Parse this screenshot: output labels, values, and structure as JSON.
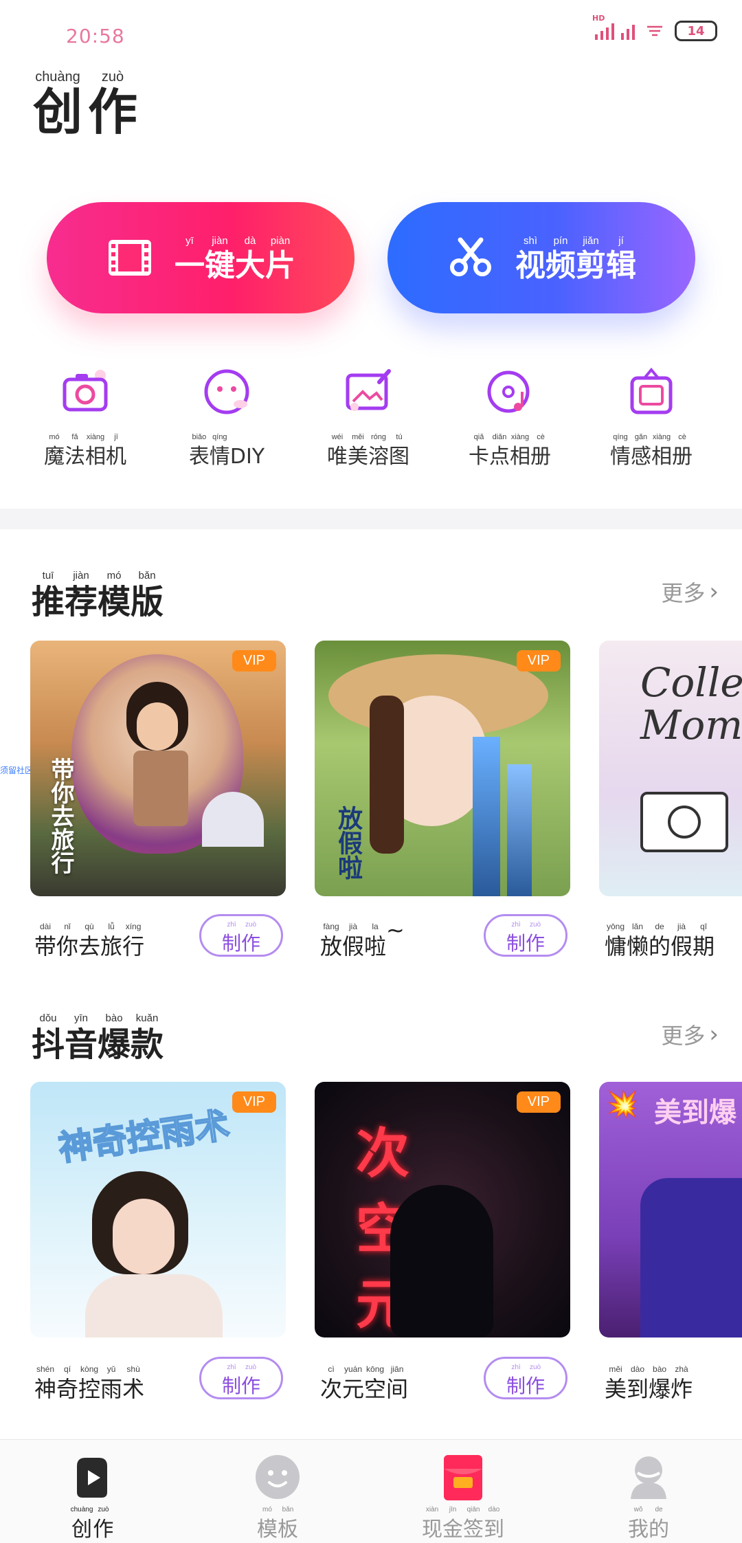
{
  "status_bar": {
    "time": "20:58",
    "network": "HD",
    "battery": "14"
  },
  "header": {
    "title_pinyin": [
      "chuàng",
      "zuò"
    ],
    "title_chars": [
      "创",
      "作"
    ]
  },
  "main_buttons": [
    {
      "pinyin": [
        "yī",
        "jiàn",
        "dà",
        "piàn"
      ],
      "chars": [
        "一",
        "键",
        "大",
        "片"
      ],
      "icon": "film-icon"
    },
    {
      "pinyin": [
        "shì",
        "pín",
        "jiǎn",
        "jí"
      ],
      "chars": [
        "视",
        "频",
        "剪",
        "辑"
      ],
      "icon": "scissors-icon"
    }
  ],
  "tools": [
    {
      "pinyin": [
        "mó",
        "fǎ",
        "xiàng",
        "jī"
      ],
      "chars": [
        "魔",
        "法",
        "相",
        "机"
      ],
      "icon": "camera-icon"
    },
    {
      "pinyin": [
        "biǎo",
        "qíng",
        "",
        ""
      ],
      "chars": [
        "表",
        "情",
        "DIY",
        ""
      ],
      "icon": "smiley-icon"
    },
    {
      "pinyin": [
        "wéi",
        "měi",
        "róng",
        "tú"
      ],
      "chars": [
        "唯",
        "美",
        "溶",
        "图"
      ],
      "icon": "image-edit-icon"
    },
    {
      "pinyin": [
        "qiǎ",
        "diǎn",
        "xiàng",
        "cè"
      ],
      "chars": [
        "卡",
        "点",
        "相",
        "册"
      ],
      "icon": "music-disc-icon"
    },
    {
      "pinyin": [
        "qíng",
        "gǎn",
        "xiàng",
        "cè"
      ],
      "chars": [
        "情",
        "感",
        "相",
        "册"
      ],
      "icon": "tv-frame-icon"
    }
  ],
  "sections": [
    {
      "title_pinyin": [
        "tuī",
        "jiàn",
        "mó",
        "bǎn"
      ],
      "title_chars": [
        "推",
        "荐",
        "模",
        "版"
      ],
      "more_label": "更多",
      "cards": [
        {
          "pinyin": [
            "dài",
            "nǐ",
            "qù",
            "lǚ",
            "xíng"
          ],
          "name": [
            "带",
            "你",
            "去",
            "旅",
            "行"
          ],
          "vip": "VIP",
          "overlay_text": "带你去旅行"
        },
        {
          "pinyin": [
            "fàng",
            "jià",
            "la",
            ""
          ],
          "name": [
            "放",
            "假",
            "啦",
            "~"
          ],
          "vip": "VIP",
          "overlay_text": "放假啦"
        },
        {
          "pinyin": [
            "yōng",
            "lǎn",
            "de",
            "jià",
            "qī"
          ],
          "name": [
            "慵",
            "懒",
            "的",
            "假",
            "期"
          ],
          "vip": "",
          "overlay_text": "Collect Moments"
        }
      ]
    },
    {
      "title_pinyin": [
        "dǒu",
        "yīn",
        "bào",
        "kuǎn"
      ],
      "title_chars": [
        "抖",
        "音",
        "爆",
        "款"
      ],
      "more_label": "更多",
      "cards": [
        {
          "pinyin": [
            "shén",
            "qí",
            "kòng",
            "yǔ",
            "shù"
          ],
          "name": [
            "神",
            "奇",
            "控",
            "雨",
            "术"
          ],
          "vip": "VIP",
          "overlay_text": "神奇控雨术"
        },
        {
          "pinyin": [
            "cì",
            "yuán",
            "kōng",
            "jiān"
          ],
          "name": [
            "次",
            "元",
            "空",
            "间"
          ],
          "vip": "VIP",
          "overlay_text": "次空元间"
        },
        {
          "pinyin": [
            "měi",
            "dào",
            "bào",
            "zhà"
          ],
          "name": [
            "美",
            "到",
            "爆",
            "炸"
          ],
          "vip": "",
          "overlay_text": "美到爆"
        }
      ]
    }
  ],
  "make_button": {
    "pinyin": [
      "zhì",
      "zuò"
    ],
    "chars": [
      "制",
      "作"
    ]
  },
  "watermark": "须留社区 CK",
  "tabbar": [
    {
      "pinyin": [
        "chuàng",
        "zuò"
      ],
      "chars": [
        "创",
        "作"
      ],
      "icon": "play-icon",
      "active": true
    },
    {
      "pinyin": [
        "mó",
        "bǎn"
      ],
      "chars": [
        "模",
        "板"
      ],
      "icon": "smile-face-icon",
      "active": false
    },
    {
      "pinyin": [
        "xiàn",
        "jīn",
        "qiān",
        "dào"
      ],
      "chars": [
        "现",
        "金",
        "签",
        "到"
      ],
      "icon": "red-envelope-icon",
      "active": false
    },
    {
      "pinyin": [
        "wǒ",
        "de"
      ],
      "chars": [
        "我",
        "的"
      ],
      "icon": "user-icon",
      "active": false
    }
  ],
  "colors": {
    "accent_pink": "#ff1f6a",
    "accent_blue": "#2d6cff",
    "accent_purple": "#8b4ee0",
    "vip_orange": "#ff8a1a"
  }
}
